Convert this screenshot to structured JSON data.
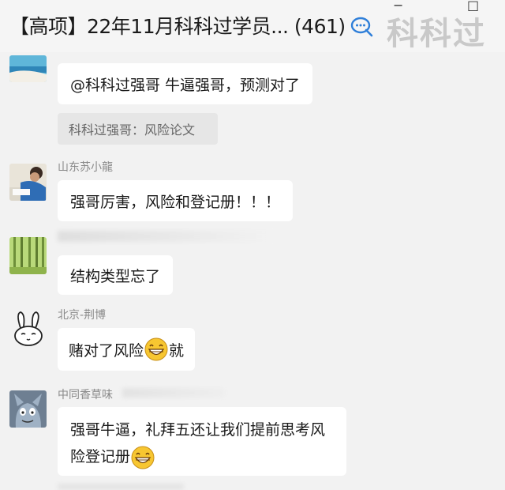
{
  "header": {
    "title": "【高项】22年11月科科过学员... (461)",
    "chat_icon": "chat-bubble-icon",
    "watermark": "科科过",
    "controls": [
      "−",
      "□"
    ]
  },
  "messages": [
    {
      "avatar_icon": "landscape-avatar",
      "text": "@科科过强哥 牛逼强哥，预测对了"
    },
    {
      "quote": "科科过强哥：风险论文"
    },
    {
      "sender": "山东苏小龍",
      "avatar_icon": "child-photo-avatar",
      "text": "强哥厉害，风险和登记册！！！"
    },
    {
      "sender": "",
      "avatar_icon": "forest-avatar",
      "text": "结构类型忘了"
    },
    {
      "sender": "北京-荆博",
      "avatar_icon": "bunny-avatar",
      "text_before": "赌对了风险",
      "emoji": "grin-emoji",
      "text_after": "就"
    },
    {
      "sender": "中同香草味",
      "avatar_icon": "tom-cat-avatar",
      "text": "强哥牛逼，礼拜五还让我们提前思考风险登记册",
      "emoji": "grin-emoji"
    }
  ],
  "colors": {
    "bubble": "#ffffff",
    "background": "#f2f2f2",
    "sender_name": "#8a8a8a"
  }
}
